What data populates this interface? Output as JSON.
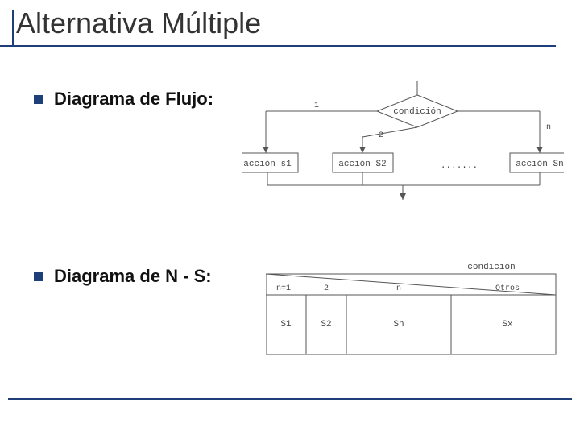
{
  "title": "Alternativa Múltiple",
  "bullets": {
    "flow": "Diagrama de Flujo:",
    "ns": "Diagrama de N - S:"
  },
  "flowchart": {
    "condition": "condición",
    "branches": [
      "1",
      "2",
      "n"
    ],
    "actions": [
      "acción s1",
      "acción S2",
      "acción Sn"
    ],
    "ellipsis": "......."
  },
  "ns": {
    "condition": "condición",
    "cases": [
      "n=1",
      "2",
      "n",
      "Otros"
    ],
    "bodies": [
      "S1",
      "S2",
      "Sn",
      "Sx"
    ]
  }
}
